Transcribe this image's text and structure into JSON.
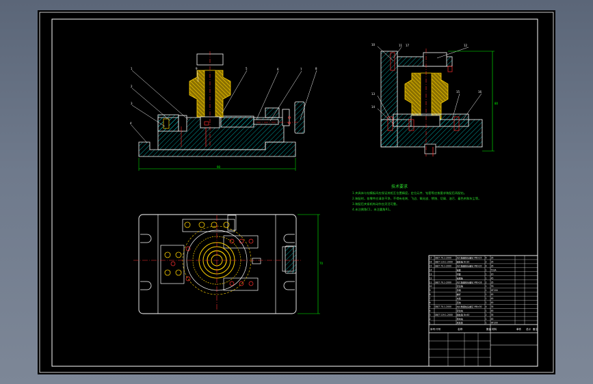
{
  "drawing": {
    "colors": {
      "background": "#000000",
      "frame": "#ffffff",
      "hatch": "#00c8c8",
      "part": "#ffd200",
      "centerline": "#ff3030",
      "dimension": "#00ff00",
      "leader": "#ffffff"
    },
    "tech_notes": {
      "title": "技术要求",
      "lines": [
        "1.夹具体与钻模板间应保证其相互位置精度，定位元件、钻套等应按要求装配后再配钻。",
        "2.装配时，各零件应清洗干净，不得有毛刺、飞边、氧化皮、锈蚀、切屑、油污、着色剂和灰尘等。",
        "3.装配后夹紧机构动作应灵活可靠。",
        "4.未注倒角C1，未注圆角R1。"
      ]
    },
    "view_labels": {
      "front": [
        "1",
        "2",
        "3",
        "4",
        "5",
        "6",
        "7",
        "8",
        "9"
      ],
      "side": [
        "10",
        "11",
        "12",
        "13",
        "14",
        "15",
        "16",
        "17"
      ]
    },
    "title_block": {
      "header": [
        "序号",
        "代号",
        "名称",
        "数量",
        "材料",
        "单件",
        "总计",
        "备注"
      ],
      "rows": [
        [
          "17",
          "GB/T 70.1-2000",
          "内六角圆柱头螺钉 M6×25",
          "4",
          "35",
          "",
          ""
        ],
        [
          "16",
          "GB/T 119.1-2000",
          "圆柱销 6×30",
          "2",
          "35",
          "",
          ""
        ],
        [
          "15",
          "GB/T 70.1-2000",
          "内六角圆柱头螺钉 M8×20",
          "4",
          "35",
          "",
          ""
        ],
        [
          "14",
          "",
          "钻套",
          "1",
          "T10A",
          "",
          ""
        ],
        [
          "13",
          "",
          "衬套",
          "1",
          "20",
          "",
          ""
        ],
        [
          "12",
          "",
          "钻模板",
          "1",
          "45",
          "",
          ""
        ],
        [
          "11",
          "GB/T 70.1-2000",
          "内六角圆柱头螺钉 M6×16",
          "2",
          "35",
          "",
          ""
        ],
        [
          "10",
          "",
          "定位销",
          "1",
          "T8",
          "",
          ""
        ],
        [
          "9",
          "",
          "手柄",
          "1",
          "HT200",
          "",
          ""
        ],
        [
          "8",
          "",
          "螺杆",
          "1",
          "45",
          "",
          ""
        ],
        [
          "7",
          "",
          "支座",
          "1",
          "45",
          "",
          ""
        ],
        [
          "6",
          "",
          "压块",
          "1",
          "45",
          "",
          ""
        ],
        [
          "5",
          "GB/T 70.1-2000",
          "内六角圆柱头螺钉 M8×30",
          "4",
          "35",
          "",
          ""
        ],
        [
          "4",
          "",
          "定位块",
          "1",
          "45",
          "",
          ""
        ],
        [
          "3",
          "GB/T 119.1-2000",
          "圆柱销 8×40",
          "2",
          "35",
          "",
          ""
        ],
        [
          "2",
          "",
          "导向块",
          "1",
          "45",
          "",
          ""
        ],
        [
          "1",
          "",
          "夹具体",
          "1",
          "HT200",
          "",
          ""
        ]
      ]
    }
  }
}
